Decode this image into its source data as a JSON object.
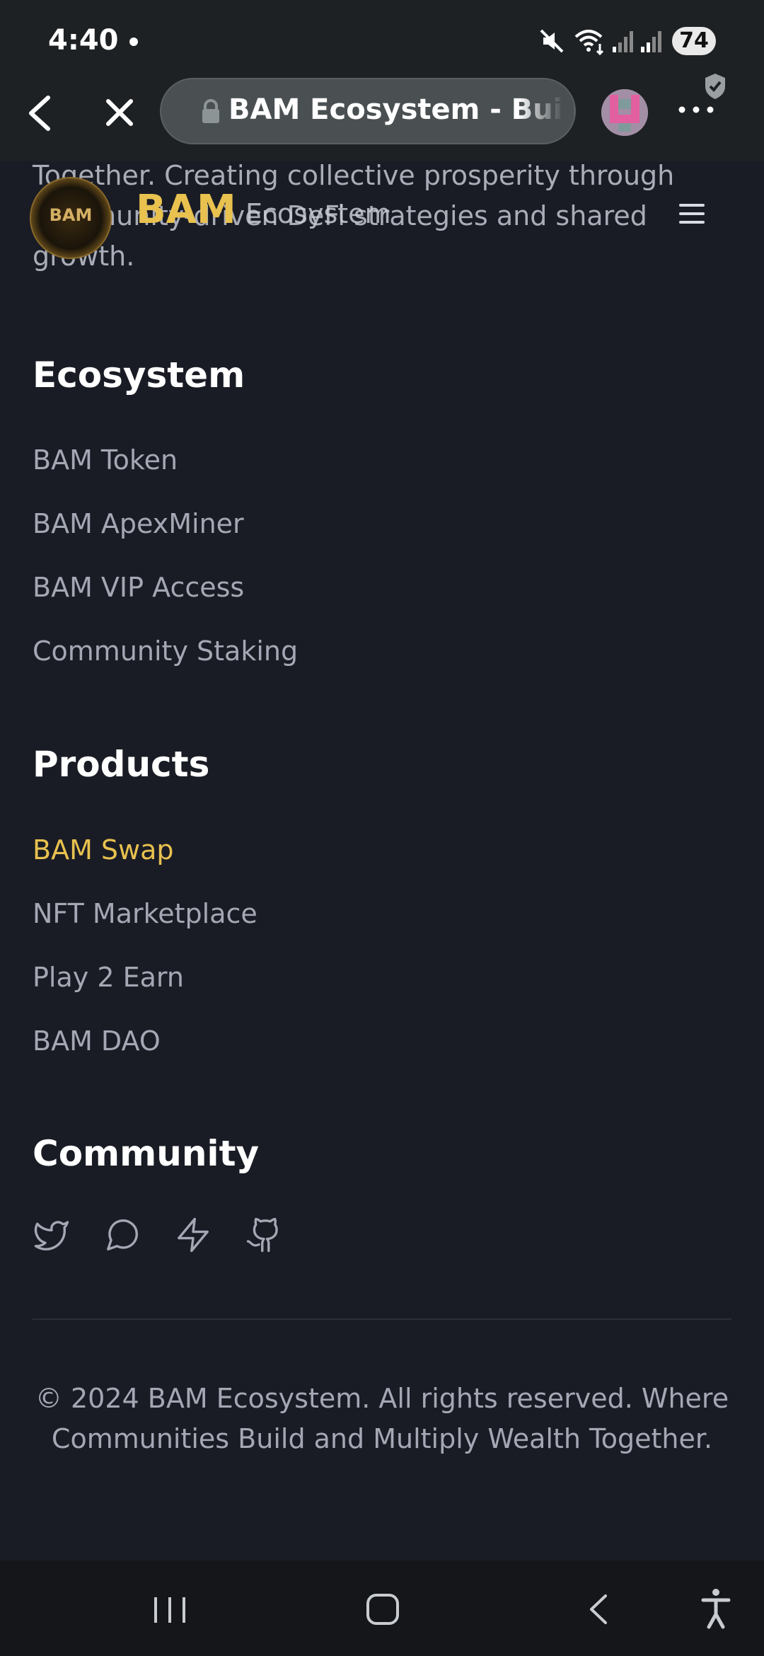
{
  "status_bar": {
    "time": "4:40",
    "battery": "74",
    "icons": [
      "mute-icon",
      "wifi-icon",
      "signal-icon",
      "signal-icon-2"
    ]
  },
  "browser": {
    "url_title": "BAM Ecosystem - Building Together",
    "back_icon": "back-arrow-icon",
    "close_icon": "close-icon",
    "lock_icon": "lock-icon",
    "menu_icon": "more-icon"
  },
  "site": {
    "logo_text": "BAM",
    "brand": "BAM",
    "brand_sub": "Ecosystem",
    "description": "Together. Creating collective prosperity through community-driven DeFi strategies and shared growth."
  },
  "sections": {
    "ecosystem": {
      "title": "Ecosystem",
      "links": [
        "BAM Token",
        "BAM ApexMiner",
        "BAM VIP Access",
        "Community Staking"
      ]
    },
    "products": {
      "title": "Products",
      "links": [
        "BAM Swap",
        "NFT Marketplace",
        "Play 2 Earn",
        "BAM DAO"
      ]
    },
    "community": {
      "title": "Community",
      "icons": [
        "twitter-icon",
        "chat-icon",
        "lightning-icon",
        "github-icon"
      ]
    }
  },
  "footer": {
    "text": "© 2024 BAM Ecosystem. All rights reserved. Where Communities Build and Multiply Wealth Together."
  },
  "colors": {
    "accent": "#e8c14f",
    "background": "#1a1c25",
    "chrome": "#1e2124"
  }
}
